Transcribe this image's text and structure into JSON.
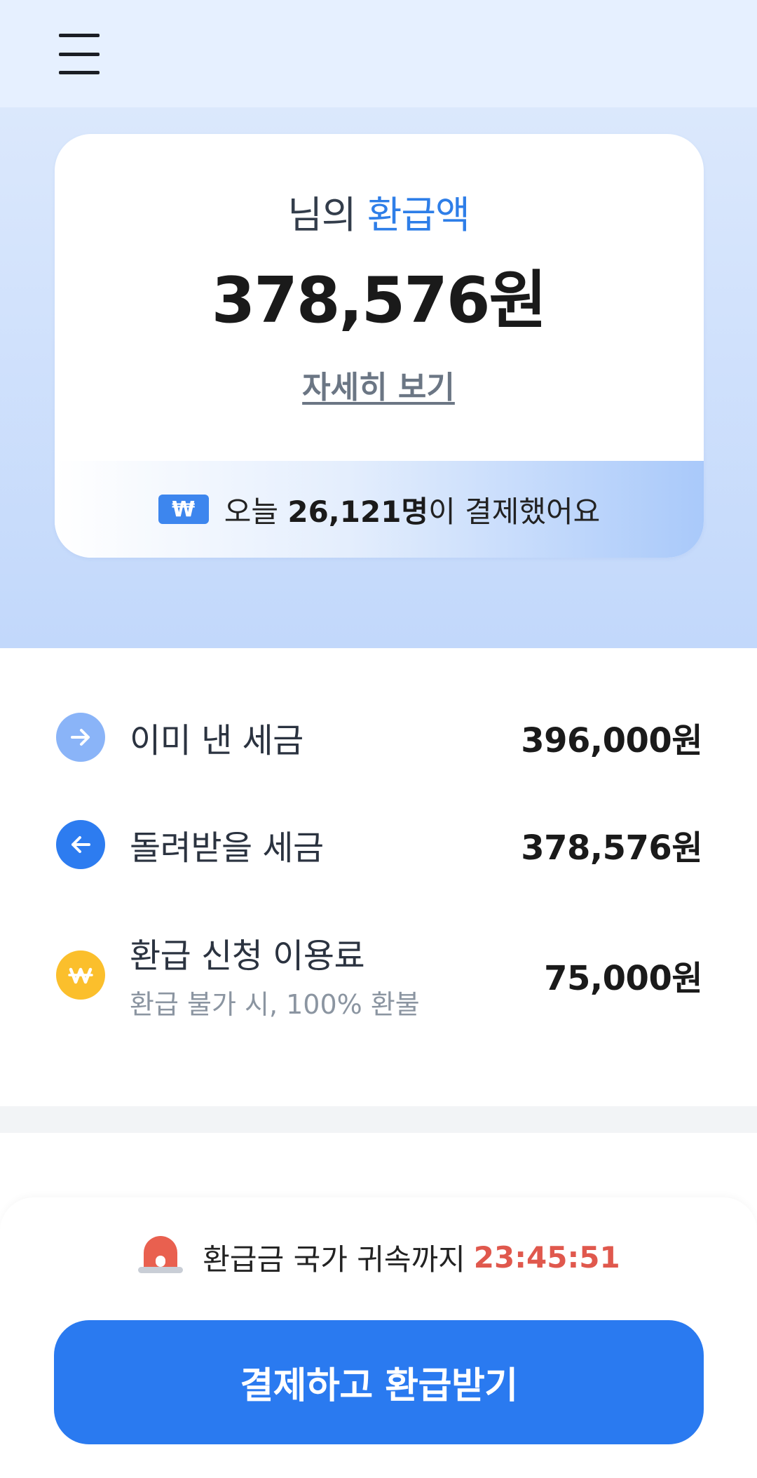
{
  "header": {
    "menu_icon": "hamburger-menu-icon"
  },
  "summary": {
    "title_prefix": "님의",
    "title_accent": "환급액",
    "amount": "378,576원",
    "detail_link": "자세히 보기",
    "footer_badge": "₩",
    "footer_text_before": "오늘",
    "footer_count": "26,121명",
    "footer_text_after": "이 결제했어요"
  },
  "rows": [
    {
      "icon": "arrow-right-icon",
      "label": "이미 낸 세금",
      "value": "396,000원"
    },
    {
      "icon": "arrow-left-icon",
      "label": "돌려받을 세금",
      "value": "378,576원"
    },
    {
      "icon": "won-coin-icon",
      "label": "환급 신청 이용료",
      "sublabel": "환급 불가 시, 100% 환불",
      "value": "75,000원"
    }
  ],
  "footer": {
    "timer_label": "환급금 국가 귀속까지",
    "timer_value": "23:45:51",
    "cta_label": "결제하고 환급받기"
  },
  "colors": {
    "accent_blue": "#2e7ee8",
    "cta_blue": "#2a7af0",
    "timer_red": "#e0584d",
    "icon_light_blue": "#8ab4f8",
    "icon_blue": "#2d7cf0",
    "icon_yellow": "#fbbf2c"
  }
}
